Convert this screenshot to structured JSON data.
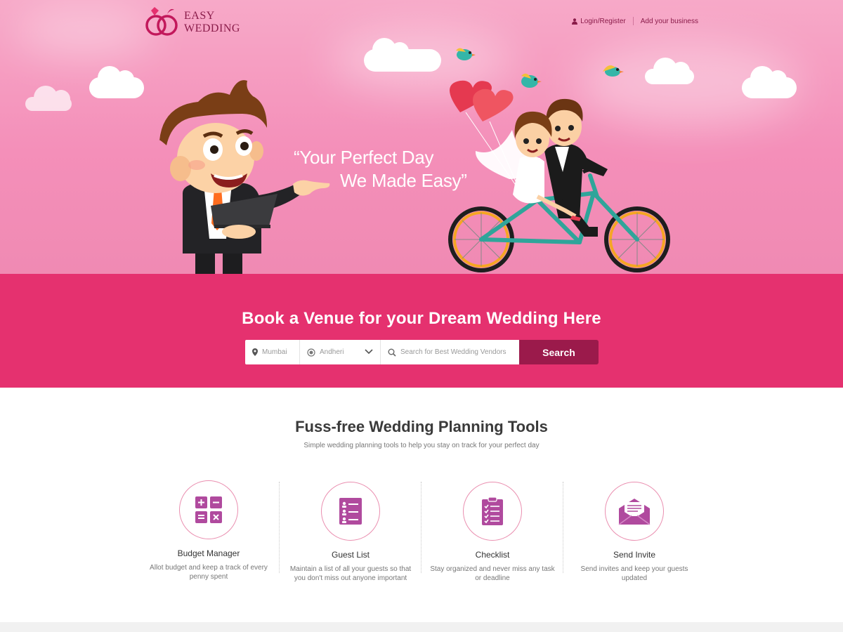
{
  "brand": {
    "line1": "EASY",
    "line2": "WEDDING"
  },
  "nav": {
    "login": "Login/Register",
    "add_business": "Add your business"
  },
  "hero": {
    "tagline_line1": "“Your Perfect Day",
    "tagline_line2": "We Made Easy”"
  },
  "search": {
    "heading": "Book a Venue for your Dream Wedding Here",
    "city_value": "Mumbai",
    "area_value": "Andheri",
    "query_placeholder": "Search for Best Wedding Vendors",
    "button_label": "Search"
  },
  "tools": {
    "title": "Fuss-free Wedding Planning Tools",
    "subtitle": "Simple wedding planning tools to help you stay on track for your perfect day",
    "items": [
      {
        "name": "Budget Manager",
        "desc": "Allot budget and keep a track of every penny spent",
        "icon": "calculator-icon"
      },
      {
        "name": "Guest List",
        "desc": "Maintain a list of all your guests so that you don't miss out anyone important",
        "icon": "guest-list-icon"
      },
      {
        "name": "Checklist",
        "desc": "Stay organized and never miss any task or deadline",
        "icon": "clipboard-checklist-icon"
      },
      {
        "name": "Send Invite",
        "desc": "Send invites and keep your guests updated",
        "icon": "envelope-invite-icon"
      }
    ]
  },
  "colors": {
    "brand": "#e5316f",
    "brand_dark": "#9b1a4b",
    "icon_purple": "#b04a9e",
    "hero_pink": "#f48fb9"
  }
}
